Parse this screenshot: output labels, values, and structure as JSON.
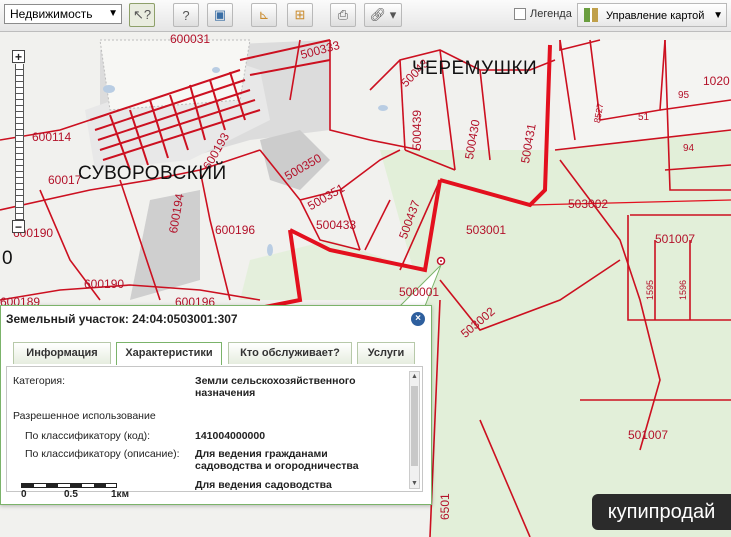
{
  "toolbar": {
    "layer_select": "Недвижимость",
    "legend_label": "Легенда",
    "map_control_label": "Управление картой"
  },
  "map": {
    "place_labels": [
      "СУВОРОВСКИЙ",
      "ЧЕРЕМУШКИ"
    ],
    "cadastral_labels": {
      "l600031": "600031",
      "l500333": "500333",
      "l600114": "600114",
      "l500350": "500350",
      "l600193": "600193",
      "l500351": "500351",
      "l500439": "500439",
      "l500430": "500430",
      "l500431": "500431",
      "l500433": "500433",
      "l500437": "500437",
      "l503001": "503001",
      "l503002": "503002",
      "l503002b": "503002",
      "l501007": "501007",
      "l501007b": "501007",
      "l600196": "600196",
      "l600196b": "600196",
      "l600190": "600190",
      "l600190b": "600190",
      "l600189": "600189",
      "l600194": "600194",
      "l8527": "8527",
      "l95": "95",
      "l51": "51",
      "l94": "94",
      "l1020": "1020",
      "l1595": "1595",
      "l1596": "1596",
      "l500001": "500001",
      "l6501": "6501",
      "l500043": "50043",
      "l60017": "60017",
      "l0": "0"
    }
  },
  "popup": {
    "title": "Земельный участок: 24:04:0503001:307",
    "tabs": [
      "Информация",
      "Характеристики",
      "Кто обслуживает?",
      "Услуги"
    ],
    "rows": {
      "category_label": "Категория:",
      "category_value": "Земли сельскохозяйственного назначения",
      "permitted_use_label": "Разрешенное использование",
      "code_label": "По классификатору (код):",
      "code_value": "141004000000",
      "desc_label": "По классификатору (описание):",
      "desc_value": "Для ведения гражданами садоводства и огородничества",
      "extra_value": "Для ведения садоводства"
    },
    "scale": {
      "s0": "0",
      "s05": "0.5",
      "s1": "1км"
    }
  },
  "watermark": "купипродай"
}
